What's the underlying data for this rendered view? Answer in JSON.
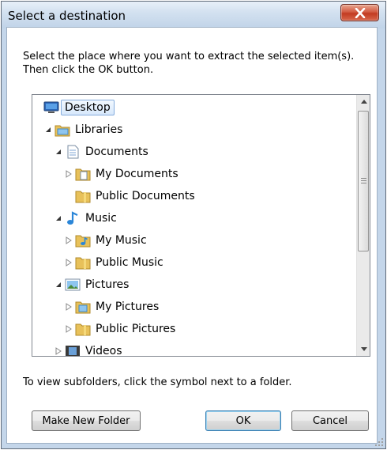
{
  "window": {
    "title": "Select a destination",
    "close_icon": "close-icon"
  },
  "instruction": {
    "line1": "Select the place where you want to extract the selected item(s).",
    "line2": "Then click the OK button."
  },
  "tree": {
    "items": [
      {
        "label": "Desktop",
        "icon": "desktop-icon",
        "expander": "none",
        "selected": true
      },
      {
        "label": "Libraries",
        "icon": "libraries-icon",
        "expander": "expanded"
      },
      {
        "label": "Documents",
        "icon": "documents-library-icon",
        "expander": "expanded"
      },
      {
        "label": "My Documents",
        "icon": "documents-folder-icon",
        "expander": "collapsed"
      },
      {
        "label": "Public Documents",
        "icon": "folder-icon",
        "expander": "none"
      },
      {
        "label": "Music",
        "icon": "music-library-icon",
        "expander": "expanded"
      },
      {
        "label": "My Music",
        "icon": "music-folder-icon",
        "expander": "collapsed"
      },
      {
        "label": "Public Music",
        "icon": "folder-icon",
        "expander": "collapsed"
      },
      {
        "label": "Pictures",
        "icon": "pictures-library-icon",
        "expander": "expanded"
      },
      {
        "label": "My Pictures",
        "icon": "pictures-folder-icon",
        "expander": "collapsed"
      },
      {
        "label": "Public Pictures",
        "icon": "folder-icon",
        "expander": "collapsed"
      },
      {
        "label": "Videos",
        "icon": "videos-library-icon",
        "expander": "collapsed"
      }
    ]
  },
  "hint": "To view subfolders, click the symbol next to a folder.",
  "buttons": {
    "new_folder": "Make New Folder",
    "ok": "OK",
    "cancel": "Cancel"
  },
  "colors": {
    "title_bar": "#c4d6ea",
    "close_button": "#c23b21",
    "selection": "#d7e8fb",
    "default_button_border": "#3c7fb1"
  }
}
